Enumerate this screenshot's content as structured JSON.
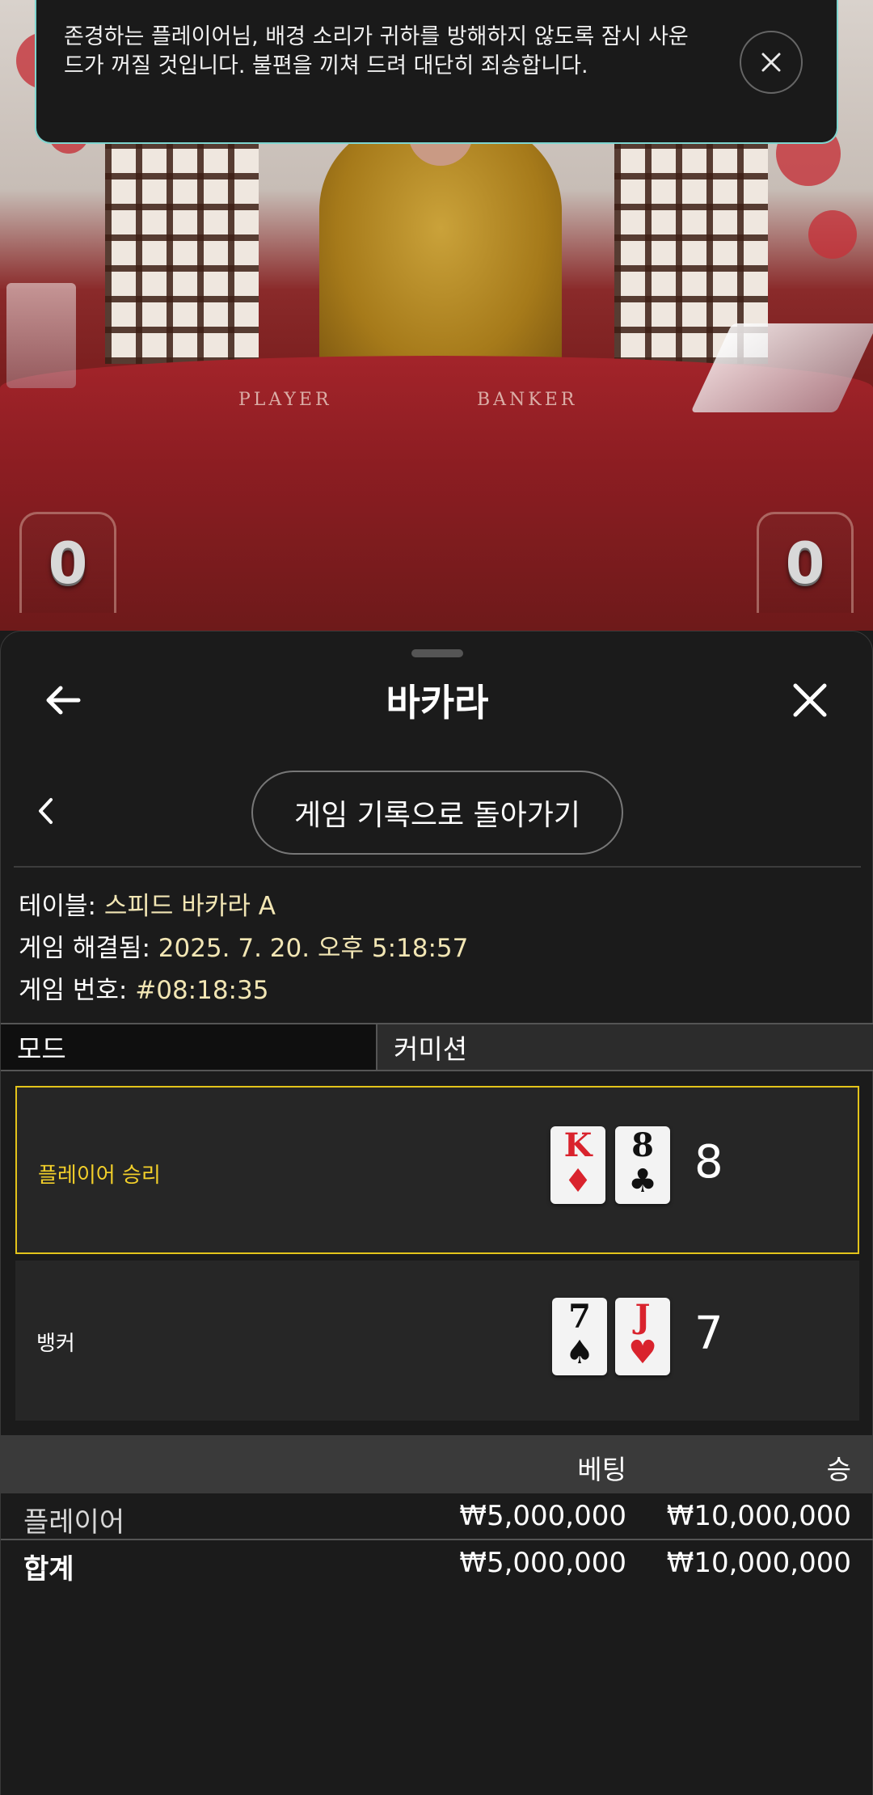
{
  "notice": {
    "text": "존경하는 플레이어님, 배경 소리가 귀하를 방해하지 않도록 잠시 사운드가 꺼질 것입니다. 불편을 끼쳐 드려 대단히 죄송합니다."
  },
  "video": {
    "felt_player_label": "PLAYER",
    "felt_banker_label": "BANKER",
    "player_score": "0",
    "banker_score": "0"
  },
  "header": {
    "title": "바카라"
  },
  "history_button": "게임 기록으로 돌아가기",
  "details": {
    "table_label": "테이블:",
    "table_value": "스피드 바카라 A",
    "resolved_label": "게임 해결됨:",
    "resolved_value": "2025. 7. 20. 오후 5:18:57",
    "game_number_label": "게임 번호:",
    "game_number_value": "#08:18:35"
  },
  "mode": {
    "label": "모드",
    "value": "커미션"
  },
  "hands": [
    {
      "label": "플레이어 승리",
      "cards": [
        {
          "rank": "K",
          "suit": "♦",
          "color": "#d9232d"
        },
        {
          "rank": "8",
          "suit": "♣",
          "color": "#111111"
        }
      ],
      "total": "8",
      "winner": true
    },
    {
      "label": "뱅커",
      "cards": [
        {
          "rank": "7",
          "suit": "♠",
          "color": "#111111"
        },
        {
          "rank": "J",
          "suit": "♥",
          "color": "#d9232d"
        }
      ],
      "total": "7",
      "winner": false
    }
  ],
  "bets": {
    "headers": {
      "bet": "베팅",
      "win": "승"
    },
    "rows": [
      {
        "name": "플레이어",
        "bet": "₩5,000,000",
        "win": "₩10,000,000"
      }
    ],
    "total": {
      "name": "합계",
      "bet": "₩5,000,000",
      "win": "₩10,000,000"
    }
  },
  "colors": {
    "accent_gold": "#e3c31b",
    "info_value": "#f2e6b4",
    "toast_border": "#7fd6d0",
    "card_red": "#d9232d"
  }
}
